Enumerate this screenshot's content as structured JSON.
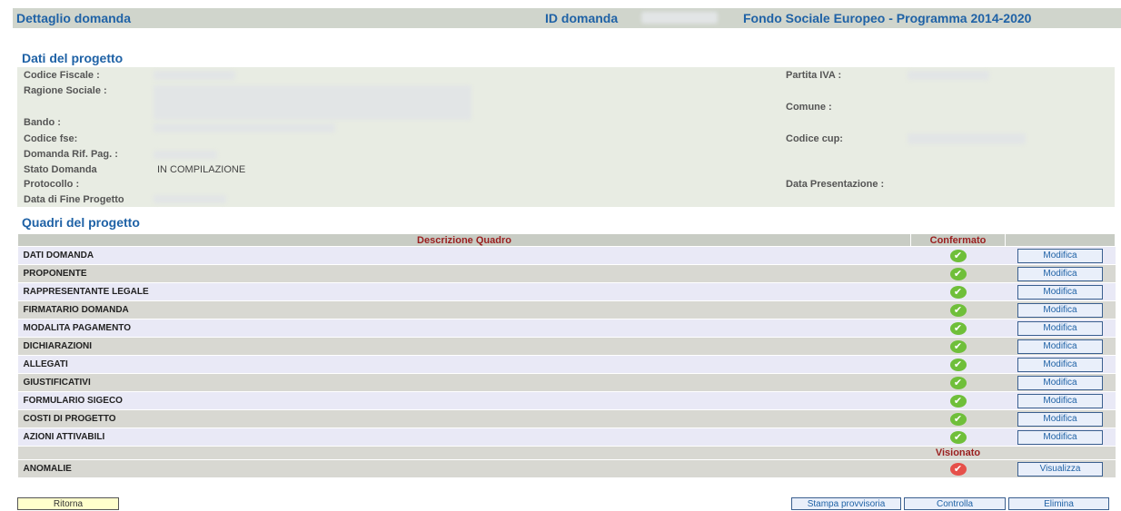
{
  "header": {
    "title": "Dettaglio domanda",
    "id_label": "ID domanda",
    "program": "Fondo Sociale Europeo - Programma 2014-2020"
  },
  "project": {
    "section_title": "Dati del progetto",
    "codice_fiscale_label": "Codice Fiscale :",
    "partita_iva_label": "Partita IVA :",
    "ragione_sociale_label": "Ragione Sociale :",
    "comune_label": "Comune :",
    "bando_label": "Bando :",
    "codice_fse_label": "Codice fse:",
    "codice_cup_label": "Codice cup:",
    "domanda_rif_label": "Domanda Rif. Pag. :",
    "stato_label": "Stato Domanda",
    "stato_value": "IN COMPILAZIONE",
    "protocollo_label": "Protocollo :",
    "data_presentazione_label": "Data Presentazione :",
    "data_fine_label": "Data di Fine Progetto"
  },
  "quadri": {
    "section_title": "Quadri del progetto",
    "col_descrizione": "Descrizione Quadro",
    "col_confermato": "Confermato",
    "rows": [
      {
        "label": "DATI DOMANDA",
        "button": "Modifica"
      },
      {
        "label": "PROPONENTE",
        "button": "Modifica"
      },
      {
        "label": "RAPPRESENTANTE LEGALE",
        "button": "Modifica"
      },
      {
        "label": "FIRMATARIO DOMANDA",
        "button": "Modifica"
      },
      {
        "label": "MODALITA PAGAMENTO",
        "button": "Modifica"
      },
      {
        "label": "DICHIARAZIONI",
        "button": "Modifica"
      },
      {
        "label": "ALLEGATI",
        "button": "Modifica"
      },
      {
        "label": "GIUSTIFICATIVI",
        "button": "Modifica"
      },
      {
        "label": "FORMULARIO SIGECO",
        "button": "Modifica"
      },
      {
        "label": "COSTI DI PROGETTO",
        "button": "Modifica"
      },
      {
        "label": "AZIONI ATTIVABILI",
        "button": "Modifica"
      }
    ],
    "col_visionato": "Visionato",
    "anomalie": {
      "label": "ANOMALIE",
      "button": "Visualizza"
    }
  },
  "footer": {
    "ritorna": "Ritorna",
    "stampa": "Stampa provvisoria",
    "controlla": "Controlla",
    "elimina": "Elimina"
  },
  "colors": {
    "accent": "#1f62a6",
    "header_text_red": "#9a1e1e",
    "check_green": "#6fbf3a",
    "check_red": "#e6504a"
  }
}
